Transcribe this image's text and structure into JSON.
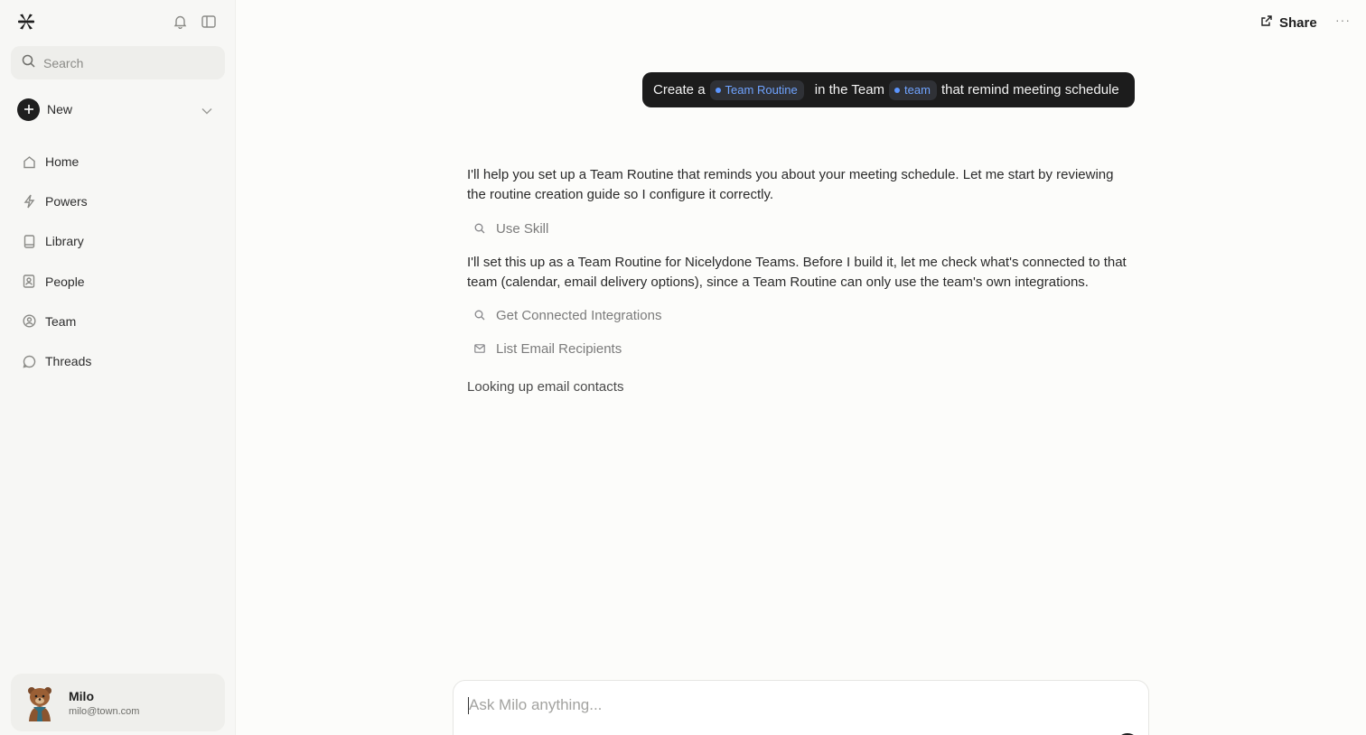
{
  "sidebar": {
    "search_placeholder": "Search",
    "new_label": "New",
    "items": [
      {
        "label": "Home",
        "icon": "home-icon"
      },
      {
        "label": "Powers",
        "icon": "bolt-icon"
      },
      {
        "label": "Library",
        "icon": "book-icon"
      },
      {
        "label": "People",
        "icon": "contact-icon"
      },
      {
        "label": "Team",
        "icon": "team-icon"
      },
      {
        "label": "Threads",
        "icon": "chat-bubble-icon"
      }
    ],
    "user": {
      "name": "Milo",
      "email": "milo@town.com"
    }
  },
  "header": {
    "share_label": "Share",
    "more_label": "···"
  },
  "user_message": {
    "part1": "Create a",
    "chip1": "Team Routine",
    "part2": "in the Team",
    "chip2": "team",
    "part3": "that remind meeting schedule"
  },
  "assistant": {
    "para1": "I'll help you set up a Team Routine that reminds you about your meeting schedule. Let me start by reviewing the routine creation guide so I configure it correctly.",
    "tool1": "Use Skill",
    "para2": "I'll set this up as a Team Routine for Nicelydone Teams. Before I build it, let me check what's connected to that team (calendar, email delivery options), since a Team Routine can only use the team's own integrations.",
    "tool2": "Get Connected Integrations",
    "tool3": "List Email Recipients",
    "status": "Looking up email contacts"
  },
  "composer": {
    "placeholder": "Ask Milo anything..."
  },
  "colors": {
    "accent_chip_text": "#6fa3ff",
    "bubble_bg": "#1c1c1c",
    "sidebar_bg": "#f7f7f5"
  }
}
